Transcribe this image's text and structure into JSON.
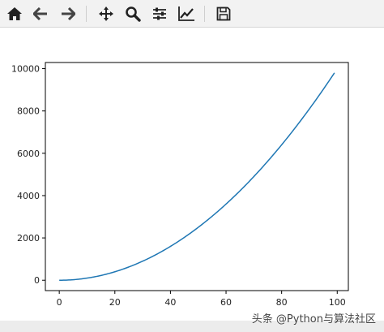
{
  "toolbar": {
    "icons": [
      "home-icon",
      "back-arrow-icon",
      "forward-arrow-icon",
      "pan-icon",
      "zoom-icon",
      "configure-subplots-icon",
      "edit-axis-icon",
      "save-icon"
    ]
  },
  "watermark": "头条 @Python与算法社区",
  "chart_data": {
    "type": "line",
    "title": "",
    "xlabel": "",
    "ylabel": "",
    "x_range": [
      0,
      99
    ],
    "function": "y = x^2",
    "xlim": [
      -5,
      104
    ],
    "ylim": [
      -490,
      10290
    ],
    "x_ticks": [
      0,
      20,
      40,
      60,
      80,
      100
    ],
    "y_ticks": [
      0,
      2000,
      4000,
      6000,
      8000,
      10000
    ],
    "grid": false,
    "legend": "none",
    "line_color": "#1f77b4",
    "series": [
      {
        "x": [
          0,
          5,
          10,
          15,
          20,
          25,
          30,
          35,
          40,
          45,
          50,
          55,
          60,
          65,
          70,
          75,
          80,
          85,
          90,
          95,
          99
        ],
        "y": [
          0,
          25,
          100,
          225,
          400,
          625,
          900,
          1225,
          1600,
          2025,
          2500,
          3025,
          3600,
          4225,
          4900,
          5625,
          6400,
          7225,
          8100,
          9025,
          9801
        ]
      }
    ]
  }
}
